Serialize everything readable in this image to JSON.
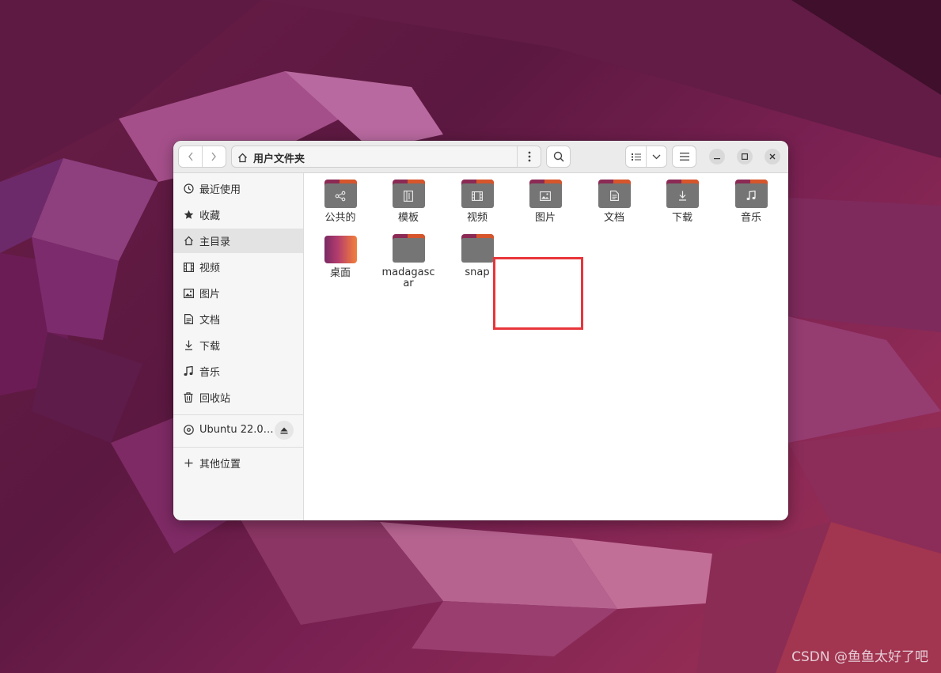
{
  "window": {
    "path_label": "用户文件夹"
  },
  "sidebar": {
    "items": [
      {
        "label": "最近使用",
        "icon": "clock-icon"
      },
      {
        "label": "收藏",
        "icon": "star-icon"
      },
      {
        "label": "主目录",
        "icon": "home-icon",
        "active": true
      },
      {
        "label": "视频",
        "icon": "film-icon"
      },
      {
        "label": "图片",
        "icon": "image-icon"
      },
      {
        "label": "文档",
        "icon": "document-icon"
      },
      {
        "label": "下载",
        "icon": "download-icon"
      },
      {
        "label": "音乐",
        "icon": "music-icon"
      },
      {
        "label": "回收站",
        "icon": "trash-icon"
      }
    ],
    "device": {
      "label": "Ubuntu 22.0…",
      "icon": "disc-icon"
    },
    "other_locations": {
      "label": "其他位置",
      "icon": "plus-icon"
    }
  },
  "files": [
    {
      "label": "公共的",
      "icon": "share-icon"
    },
    {
      "label": "模板",
      "icon": "template-icon"
    },
    {
      "label": "视频",
      "icon": "film-icon"
    },
    {
      "label": "图片",
      "icon": "image-icon"
    },
    {
      "label": "文档",
      "icon": "document-icon"
    },
    {
      "label": "下载",
      "icon": "download-icon"
    },
    {
      "label": "音乐",
      "icon": "music-icon"
    },
    {
      "label": "桌面",
      "icon": "desktop-icon"
    },
    {
      "label": "madagascar",
      "icon": "folder-icon"
    },
    {
      "label": "snap",
      "icon": "folder-icon"
    }
  ],
  "watermark": "CSDN @鱼鱼太好了吧",
  "colors": {
    "highlight": "#e8353a",
    "folder_body": "#757575",
    "folder_tab": "#8b2a54",
    "wallpaper": "#6a1e48"
  }
}
